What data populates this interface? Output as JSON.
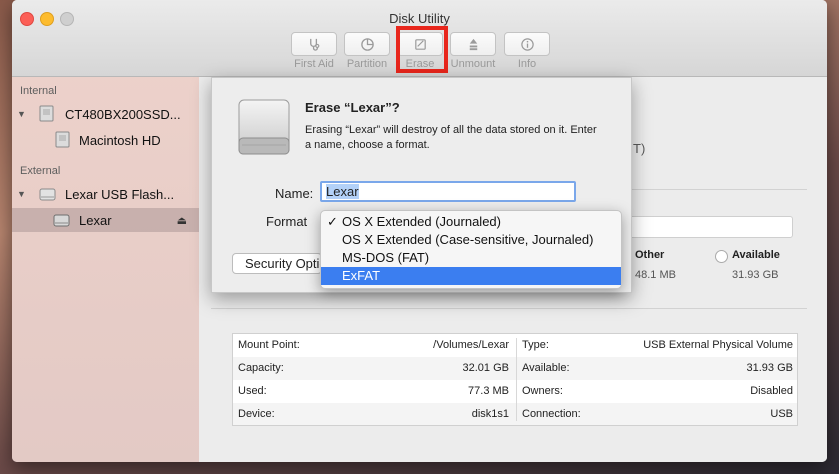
{
  "window": {
    "title": "Disk Utility"
  },
  "toolbar": [
    {
      "label": "First Aid",
      "icon": "stethoscope-icon"
    },
    {
      "label": "Partition",
      "icon": "pie-icon"
    },
    {
      "label": "Erase",
      "icon": "erase-icon"
    },
    {
      "label": "Unmount",
      "icon": "unmount-icon"
    },
    {
      "label": "Info",
      "icon": "info-icon"
    }
  ],
  "sidebar": {
    "internal_header": "Internal",
    "external_header": "External",
    "items": [
      {
        "label": "CT480BX200SSD...",
        "icon": "internal-disk-icon"
      },
      {
        "label": "Macintosh HD",
        "icon": "volume-icon"
      },
      {
        "label": "Lexar USB Flash...",
        "icon": "external-disk-icon"
      },
      {
        "label": "Lexar",
        "icon": "volume-icon"
      }
    ]
  },
  "main": {
    "partial_paren": "T)",
    "legend_other": "Other",
    "legend_other_value": "48.1 MB",
    "legend_available": "Available",
    "legend_available_value": "31.93 GB"
  },
  "info": {
    "left": [
      {
        "k": "Mount Point:",
        "v": "/Volumes/Lexar"
      },
      {
        "k": "Capacity:",
        "v": "32.01 GB"
      },
      {
        "k": "Used:",
        "v": "77.3 MB"
      },
      {
        "k": "Device:",
        "v": "disk1s1"
      }
    ],
    "right": [
      {
        "k": "Type:",
        "v": "USB External Physical Volume"
      },
      {
        "k": "Available:",
        "v": "31.93 GB"
      },
      {
        "k": "Owners:",
        "v": "Disabled"
      },
      {
        "k": "Connection:",
        "v": "USB"
      }
    ]
  },
  "sheet": {
    "title": "Erase “Lexar”?",
    "message": "Erasing “Lexar” will destroy of all the data stored on it. Enter a name, choose a format.",
    "name_label": "Name:",
    "name_value": "Lexar",
    "format_label": "Format",
    "security_button": "Security Options..."
  },
  "format_menu": {
    "check": "✓",
    "options": [
      "OS X Extended (Journaled)",
      "OS X Extended (Case-sensitive, Journaled)",
      "MS-DOS (FAT)",
      "ExFAT"
    ]
  },
  "colors": {
    "accent": "#3b7ef0",
    "highlight_box": "#e8261c"
  }
}
